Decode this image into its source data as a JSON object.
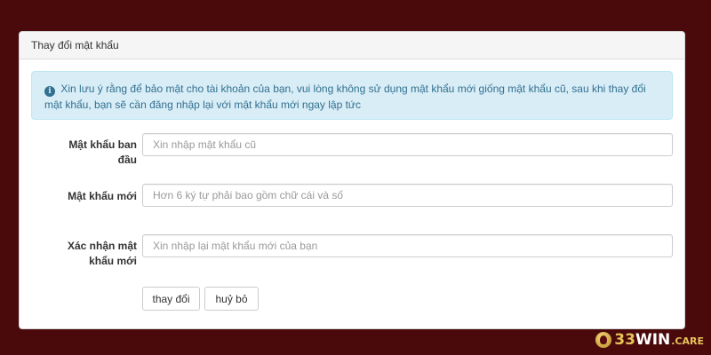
{
  "panel": {
    "title": "Thay đổi mật khẩu"
  },
  "alert": {
    "icon": "info-circle-icon",
    "text": "Xin lưu ý rằng để bảo mật cho tài khoản của bạn, vui lòng không sử dụng mật khẩu mới giống mật khẩu cũ, sau khi thay đổi mật khẩu, bạn sẽ cần đăng nhập lại với mật khẩu mới ngay lập tức"
  },
  "form": {
    "old_password": {
      "label_line1": "Mật khẩu ban",
      "label_line2": "đầu",
      "value": "",
      "placeholder": "Xin nhập mật khẩu cũ"
    },
    "new_password": {
      "label": "Mật khẩu mới",
      "value": "",
      "placeholder": "Hơn 6 ký tự phải bao gồm chữ cái và số"
    },
    "confirm_password": {
      "label_line1": "Xác nhận mật",
      "label_line2": "khẩu mới",
      "value": "",
      "placeholder": "Xin nhập lại mật khẩu mới của bạn"
    }
  },
  "buttons": {
    "submit_label": "thay đổi",
    "cancel_label": "huỷ bỏ"
  },
  "watermark": {
    "num": "33",
    "win": "WIN",
    "care": ".CARE"
  },
  "colors": {
    "background": "#4a0a0c",
    "alert_bg": "#d9edf7",
    "alert_text": "#31708f",
    "logo_gold": "#e7c35a"
  }
}
